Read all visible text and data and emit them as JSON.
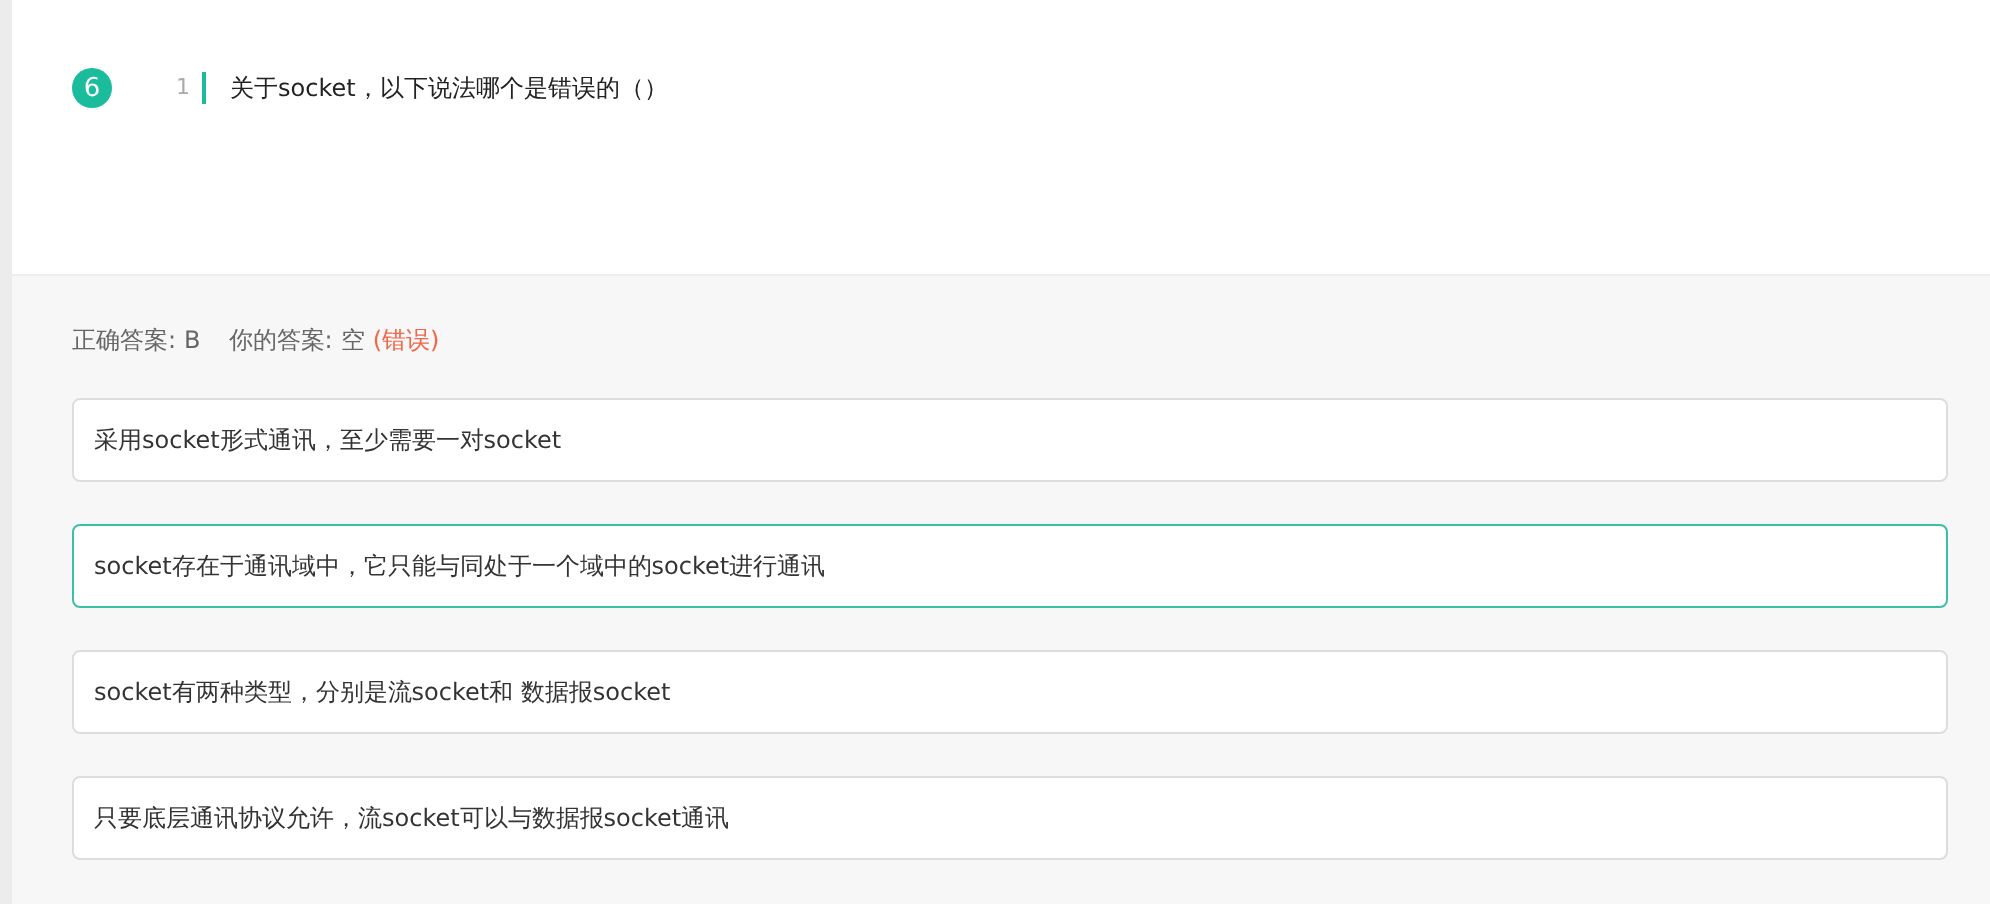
{
  "question": {
    "number": "6",
    "line_number": "1",
    "text": "关于socket，以下说法哪个是错误的（）"
  },
  "result": {
    "correct_label": "正确答案:",
    "correct_value": "B",
    "your_label": "你的答案:",
    "your_value": "空",
    "verdict": "(错误)"
  },
  "options": [
    {
      "text": "采用socket形式通讯，至少需要一对socket",
      "correct": false
    },
    {
      "text": "socket存在于通讯域中，它只能与同处于一个域中的socket进行通讯",
      "correct": true
    },
    {
      "text": "socket有两种类型，分别是流socket和 数据报socket",
      "correct": false
    },
    {
      "text": "只要底层通讯协议允许，流socket可以与数据报socket通讯",
      "correct": false
    }
  ]
}
